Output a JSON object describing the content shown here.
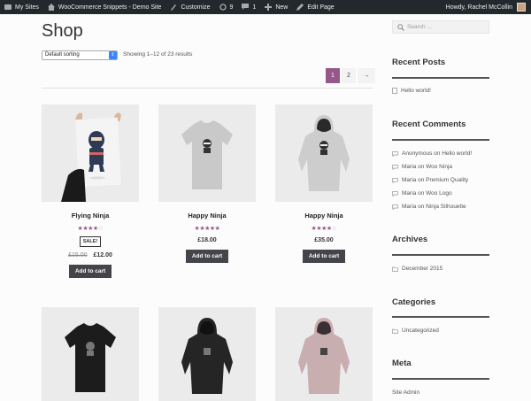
{
  "admin_bar": {
    "my_sites": "My Sites",
    "site_name": "WooCommerce Snippets - Demo Site",
    "customize": "Customize",
    "updates_count": "9",
    "comments_count": "1",
    "new": "New",
    "edit_page": "Edit Page",
    "howdy": "Howdy, Rachel McCollin"
  },
  "page": {
    "title": "Shop",
    "sorting": "Default sorting",
    "result_count": "Showing 1–12 of 23 results"
  },
  "pagination": {
    "pages": [
      "1",
      "2"
    ],
    "next": "→",
    "current": "1"
  },
  "products": [
    {
      "name": "Flying Ninja",
      "rating": 4,
      "sale_badge": "SALE!",
      "old_price": "£15.00",
      "price": "£12.00",
      "button": "Add to cart"
    },
    {
      "name": "Happy Ninja",
      "rating": 5,
      "price": "£18.00",
      "button": "Add to cart"
    },
    {
      "name": "Happy Ninja",
      "rating": 4,
      "price": "£35.00",
      "button": "Add to cart"
    }
  ],
  "sidebar": {
    "search_placeholder": "Search …",
    "recent_posts_title": "Recent Posts",
    "recent_posts": [
      "Hello world!"
    ],
    "recent_comments_title": "Recent Comments",
    "recent_comments": [
      {
        "author": "Anonymous",
        "on": "on",
        "post": "Hello world!"
      },
      {
        "author": "Maria",
        "on": "on",
        "post": "Woo Ninja"
      },
      {
        "author": "Maria",
        "on": "on",
        "post": "Premium Quality"
      },
      {
        "author": "Maria",
        "on": "on",
        "post": "Woo Logo"
      },
      {
        "author": "Maria",
        "on": "on",
        "post": "Ninja Silhouette"
      }
    ],
    "archives_title": "Archives",
    "archives": [
      "December 2015"
    ],
    "categories_title": "Categories",
    "categories": [
      "Uncategorized"
    ],
    "meta_title": "Meta",
    "meta_items": [
      "Site Admin"
    ]
  },
  "colors": {
    "accent": "#96588a",
    "admin_bar": "#23282d",
    "button": "#43454b"
  }
}
